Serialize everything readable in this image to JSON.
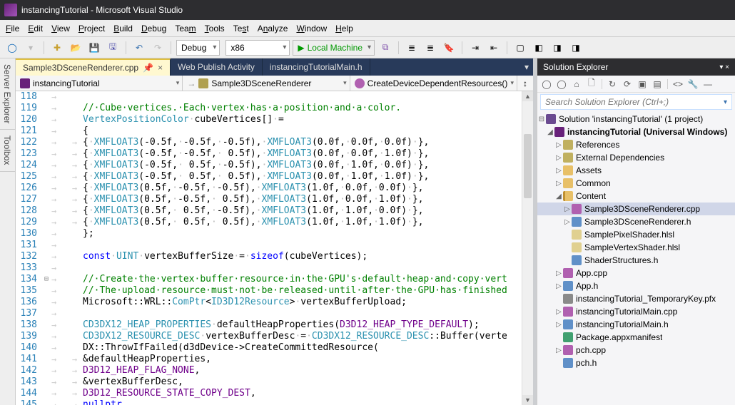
{
  "window": {
    "title": "instancingTutorial - Microsoft Visual Studio"
  },
  "menu": {
    "file": "File",
    "edit": "Edit",
    "view": "View",
    "project": "Project",
    "build": "Build",
    "debug": "Debug",
    "team": "Team",
    "tools": "Tools",
    "test": "Test",
    "analyze": "Analyze",
    "window": "Window",
    "help": "Help"
  },
  "toolbar": {
    "config": "Debug",
    "platform": "x86",
    "run": "Local Machine"
  },
  "tabs": {
    "active": "Sample3DSceneRenderer.cpp",
    "inactive1": "Web Publish Activity",
    "inactive2": "instancingTutorialMain.h"
  },
  "context": {
    "project": "instancingTutorial",
    "class": "Sample3DSceneRenderer",
    "method": "CreateDeviceDependentResources()"
  },
  "code": {
    "first_line": 118,
    "lines": [
      {
        "i": 0,
        "html": ""
      },
      {
        "i": 0,
        "html": "<span class=c-comment>//·Cube·vertices.·Each·vertex·has·a·position·and·a·color.</span>"
      },
      {
        "i": 0,
        "html": "<span class=c-type>VertexPositionColor</span><span class=c-dim>·</span>cubeVertices[]<span class=c-dim>·</span>="
      },
      {
        "i": 0,
        "html": "{"
      },
      {
        "i": 1,
        "html": "{<span class=c-dim>·</span><span class=c-type>XMFLOAT3</span>(-0.5f,<span class=c-dim>·</span>-0.5f,<span class=c-dim>·</span>-0.5f),<span class=c-dim>·</span><span class=c-type>XMFLOAT3</span>(0.0f,<span class=c-dim>·</span>0.0f,<span class=c-dim>·</span>0.0f)<span class=c-dim>·</span>},"
      },
      {
        "i": 1,
        "html": "{<span class=c-dim>·</span><span class=c-type>XMFLOAT3</span>(-0.5f,<span class=c-dim>·</span>-0.5f,<span class=c-dim>·</span>&nbsp;0.5f),<span class=c-dim>·</span><span class=c-type>XMFLOAT3</span>(0.0f,<span class=c-dim>·</span>0.0f,<span class=c-dim>·</span>1.0f)<span class=c-dim>·</span>},"
      },
      {
        "i": 1,
        "html": "{<span class=c-dim>·</span><span class=c-type>XMFLOAT3</span>(-0.5f,<span class=c-dim>·</span>&nbsp;0.5f,<span class=c-dim>·</span>-0.5f),<span class=c-dim>·</span><span class=c-type>XMFLOAT3</span>(0.0f,<span class=c-dim>·</span>1.0f,<span class=c-dim>·</span>0.0f)<span class=c-dim>·</span>},"
      },
      {
        "i": 1,
        "html": "{<span class=c-dim>·</span><span class=c-type>XMFLOAT3</span>(-0.5f,<span class=c-dim>·</span>&nbsp;0.5f,<span class=c-dim>·</span>&nbsp;0.5f),<span class=c-dim>·</span><span class=c-type>XMFLOAT3</span>(0.0f,<span class=c-dim>·</span>1.0f,<span class=c-dim>·</span>1.0f)<span class=c-dim>·</span>},"
      },
      {
        "i": 1,
        "html": "{<span class=c-dim>·</span><span class=c-type>XMFLOAT3</span>(0.5f,<span class=c-dim>·</span>-0.5f,<span class=c-dim>·</span>-0.5f),<span class=c-dim>·</span><span class=c-type>XMFLOAT3</span>(1.0f,<span class=c-dim>·</span>0.0f,<span class=c-dim>·</span>0.0f)<span class=c-dim>·</span>},"
      },
      {
        "i": 1,
        "html": "{<span class=c-dim>·</span><span class=c-type>XMFLOAT3</span>(0.5f,<span class=c-dim>·</span>-0.5f,<span class=c-dim>·</span>&nbsp;0.5f),<span class=c-dim>·</span><span class=c-type>XMFLOAT3</span>(1.0f,<span class=c-dim>·</span>0.0f,<span class=c-dim>·</span>1.0f)<span class=c-dim>·</span>},"
      },
      {
        "i": 1,
        "html": "{<span class=c-dim>·</span><span class=c-type>XMFLOAT3</span>(0.5f,<span class=c-dim>·</span>&nbsp;0.5f,<span class=c-dim>·</span>-0.5f),<span class=c-dim>·</span><span class=c-type>XMFLOAT3</span>(1.0f,<span class=c-dim>·</span>1.0f,<span class=c-dim>·</span>0.0f)<span class=c-dim>·</span>},"
      },
      {
        "i": 1,
        "html": "{<span class=c-dim>·</span><span class=c-type>XMFLOAT3</span>(0.5f,<span class=c-dim>·</span>&nbsp;0.5f,<span class=c-dim>·</span>&nbsp;0.5f),<span class=c-dim>·</span><span class=c-type>XMFLOAT3</span>(1.0f,<span class=c-dim>·</span>1.0f,<span class=c-dim>·</span>1.0f)<span class=c-dim>·</span>},"
      },
      {
        "i": 0,
        "html": "};"
      },
      {
        "i": 0,
        "html": ""
      },
      {
        "i": 0,
        "html": "<span class=c-kw>const</span><span class=c-dim>·</span><span class=c-type>UINT</span><span class=c-dim>·</span>vertexBufferSize<span class=c-dim>·</span>=<span class=c-dim>·</span><span class=c-kw>sizeof</span>(cubeVertices);"
      },
      {
        "i": 0,
        "html": ""
      },
      {
        "i": 0,
        "html": "<span class=c-comment>//·Create·the·vertex·buffer·resource·in·the·GPU's·default·heap·and·copy·vert</span>"
      },
      {
        "i": 0,
        "html": "<span class=c-comment>//·The·upload·resource·must·not·be·released·until·after·the·GPU·has·finished</span>"
      },
      {
        "i": 0,
        "html": "Microsoft::WRL::<span class=c-type>ComPtr</span>&lt;<span class=c-type>ID3D12Resource</span>&gt;<span class=c-dim>·</span>vertexBufferUpload;"
      },
      {
        "i": 0,
        "html": ""
      },
      {
        "i": 0,
        "html": "<span class=c-type>CD3DX12_HEAP_PROPERTIES</span><span class=c-dim>·</span>defaultHeapProperties(<span class=c-macro>D3D12_HEAP_TYPE_DEFAULT</span>);"
      },
      {
        "i": 0,
        "html": "<span class=c-type>CD3DX12_RESOURCE_DESC</span><span class=c-dim>·</span>vertexBufferDesc<span class=c-dim>·</span>=<span class=c-dim>·</span><span class=c-type>CD3DX12_RESOURCE_DESC</span>::Buffer(verte"
      },
      {
        "i": 0,
        "html": "DX::ThrowIfFailed(d3dDevice-&gt;CreateCommittedResource("
      },
      {
        "i": 1,
        "html": "&amp;defaultHeapProperties,"
      },
      {
        "i": 1,
        "html": "<span class=c-macro>D3D12_HEAP_FLAG_NONE</span>,"
      },
      {
        "i": 1,
        "html": "&amp;vertexBufferDesc,"
      },
      {
        "i": 1,
        "html": "<span class=c-macro>D3D12_RESOURCE_STATE_COPY_DEST</span>,"
      },
      {
        "i": 1,
        "html": "<span class=c-kw>nullptr</span>,"
      }
    ]
  },
  "solution": {
    "title": "Solution Explorer",
    "search_placeholder": "Search Solution Explorer (Ctrl+;)",
    "root": "Solution 'instancingTutorial' (1 project)",
    "project": "instancingTutorial (Universal Windows)",
    "nodes": {
      "references": "References",
      "ext": "External Dependencies",
      "assets": "Assets",
      "common": "Common",
      "content": "Content",
      "shaderstruct": "ShaderStructures.h",
      "files": {
        "renderer_cpp": "Sample3DSceneRenderer.cpp",
        "renderer_h": "Sample3DSceneRenderer.h",
        "ps": "SamplePixelShader.hlsl",
        "vs": "SampleVertexShader.hlsl"
      },
      "app_cpp": "App.cpp",
      "app_h": "App.h",
      "pfx": "instancingTutorial_TemporaryKey.pfx",
      "main_cpp": "instancingTutorialMain.cpp",
      "main_h": "instancingTutorialMain.h",
      "manifest": "Package.appxmanifest",
      "pch_cpp": "pch.cpp",
      "pch_h": "pch.h"
    }
  }
}
